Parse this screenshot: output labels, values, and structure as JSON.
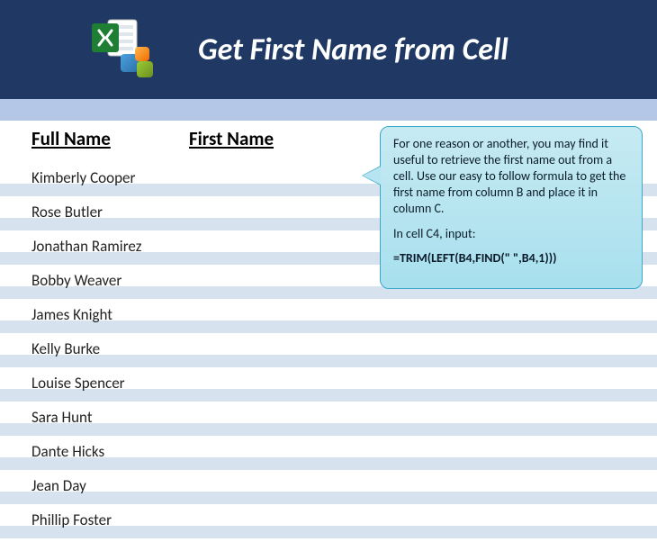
{
  "header": {
    "title": "Get First Name from Cell"
  },
  "columns": {
    "fullname_header": "Full Name",
    "firstname_header": "First Name"
  },
  "rows": [
    {
      "fullname": "Kimberly Cooper",
      "firstname": ""
    },
    {
      "fullname": "Rose Butler",
      "firstname": ""
    },
    {
      "fullname": "Jonathan Ramirez",
      "firstname": ""
    },
    {
      "fullname": "Bobby Weaver",
      "firstname": ""
    },
    {
      "fullname": "James Knight",
      "firstname": ""
    },
    {
      "fullname": "Kelly Burke",
      "firstname": ""
    },
    {
      "fullname": "Louise Spencer",
      "firstname": ""
    },
    {
      "fullname": "Sara Hunt",
      "firstname": ""
    },
    {
      "fullname": "Dante Hicks",
      "firstname": ""
    },
    {
      "fullname": "Jean Day",
      "firstname": ""
    },
    {
      "fullname": "Phillip Foster",
      "firstname": ""
    }
  ],
  "callout": {
    "p1": "For one reason or another, you may find it useful to retrieve the first name out from a cell. Use our easy to follow formula to get the first name from column B and place it in column C.",
    "p2": "In cell C4, input:",
    "formula": "=TRIM(LEFT(B4,FIND(\" \",B4,1)))"
  },
  "colors": {
    "header_bg": "#1f3864",
    "subheader_bg": "#b4c7e7",
    "stripe_bg": "#d6e3ef",
    "callout_border": "#3aa8c9"
  }
}
